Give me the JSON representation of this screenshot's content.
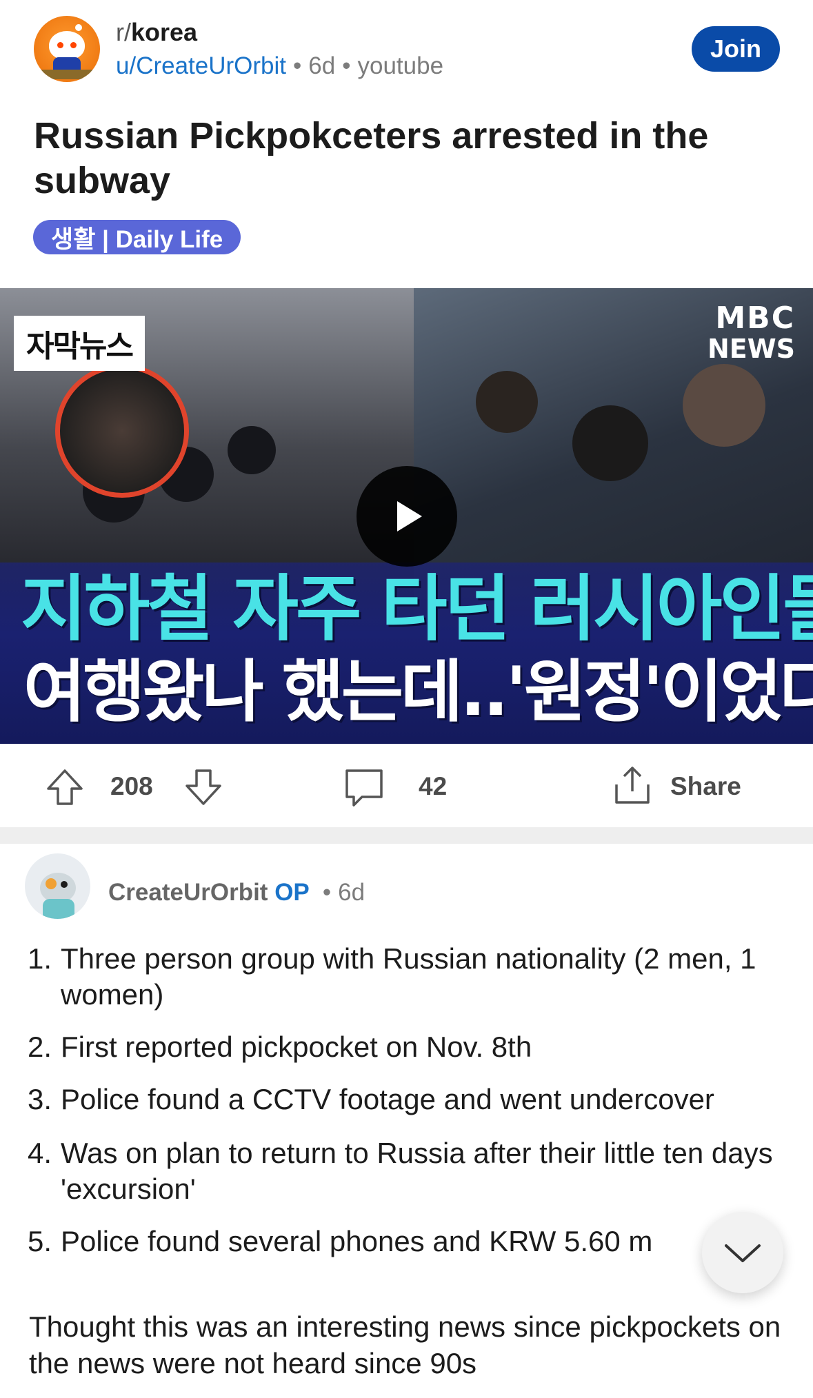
{
  "header": {
    "subreddit_prefix": "r/",
    "subreddit_name": "korea",
    "author": "u/CreateUrOrbit",
    "age": "6d",
    "source": "youtube",
    "join_label": "Join"
  },
  "post": {
    "title": "Russian Pickpokceters arrested in the subway",
    "flair": "생활 | Daily Life",
    "thumbnail": {
      "tag": "자막뉴스",
      "logo_line1": "MBC",
      "logo_line2": "NEWS",
      "caption_line1": "지하철 자주 타던 러시아인들",
      "caption_line2": "여행왔나 했는데..'원정'이었다"
    }
  },
  "actions": {
    "upvotes": "208",
    "comments": "42",
    "share_label": "Share"
  },
  "comment": {
    "author": "CreateUrOrbit",
    "op_badge": "OP",
    "age": "6d",
    "list": [
      {
        "num": "1.",
        "text": "Three person group with Russian nationality (2 men, 1 women)"
      },
      {
        "num": "2.",
        "text": "First reported pickpocket on Nov. 8th"
      },
      {
        "num": "3.",
        "text": "Police found a CCTV footage and went undercover"
      },
      {
        "num": "4.",
        "text": "Was on plan to return to Russia after their little ten days 'excursion'"
      },
      {
        "num": "5.",
        "text": "Police found several phones and KRW 5.60 m"
      }
    ],
    "paragraph": "Thought this was an interesting news since pickpockets on the news were not heard since 90s"
  },
  "colors": {
    "join_button": "#0a4ba8",
    "flair_bg": "#5a67d8",
    "link_blue": "#1a73c9",
    "caption_cyan": "#49e2e6"
  },
  "icons": [
    "upvote-icon",
    "downvote-icon",
    "comment-icon",
    "share-icon",
    "play-icon",
    "chevron-down-icon"
  ]
}
